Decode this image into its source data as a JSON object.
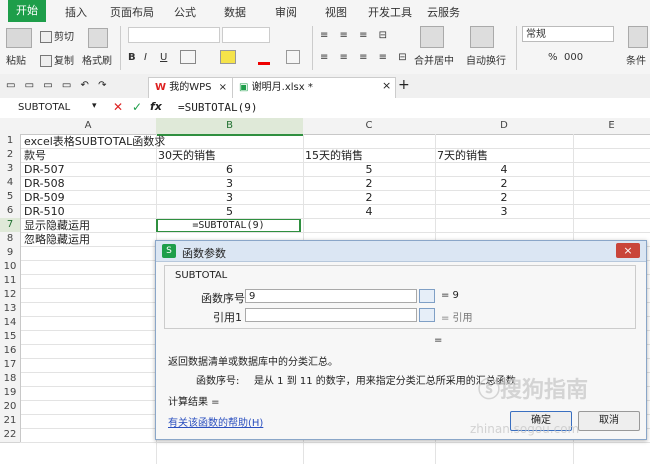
{
  "menu": {
    "tabs": [
      "开始",
      "插入",
      "页面布局",
      "公式",
      "数据",
      "审阅",
      "视图",
      "开发工具",
      "云服务"
    ],
    "active": "开始"
  },
  "ribbon": {
    "paste": "粘贴",
    "cut": "剪切",
    "copy": "复制",
    "format_painter": "格式刷",
    "bold": "B",
    "italic": "I",
    "underline": "U",
    "merge_center": "合并居中",
    "auto_wrap": "自动换行",
    "number_format": "常规",
    "percent": "%",
    "thousand": "000",
    "condition": "条件"
  },
  "doctabs": {
    "wps": "我的WPS",
    "file": "谢明月.xlsx *"
  },
  "formula_bar": {
    "name_box": "SUBTOTAL",
    "cancel": "✕",
    "confirm": "✓",
    "fx": "fx",
    "formula": "=SUBTOTAL(9)"
  },
  "columns": [
    "A",
    "B",
    "C",
    "D",
    "E"
  ],
  "rows": [
    "1",
    "2",
    "3",
    "4",
    "5",
    "6",
    "7",
    "8",
    "9",
    "10",
    "11",
    "12",
    "13",
    "14",
    "15",
    "16",
    "17",
    "18",
    "19",
    "20",
    "21",
    "22"
  ],
  "cells": {
    "a1": "excel表格SUBTOTAL函数求",
    "a2": "款号",
    "b2": "30天的销售",
    "c2": "15天的销售",
    "d2": "7天的销售",
    "a3": "DR-507",
    "b3": "6",
    "c3": "5",
    "d3": "4",
    "a4": "DR-508",
    "b4": "3",
    "c4": "2",
    "d4": "2",
    "a5": "DR-509",
    "b5": "3",
    "c5": "2",
    "d5": "2",
    "a6": "DR-510",
    "b6": "5",
    "c6": "4",
    "d6": "3",
    "a7": "显示隐藏运用",
    "b7": "=SUBTOTAL(9)",
    "a8": "忽略隐藏运用"
  },
  "dialog": {
    "title": "函数参数",
    "function_name": "SUBTOTAL",
    "arg1_label": "函数序号",
    "arg1_value": "9",
    "arg1_result": "= 9",
    "arg2_label": "引用1",
    "arg2_value": "",
    "arg2_result": "= 引用",
    "total_eq": "=",
    "description": "返回数据清单或数据库中的分类汇总。",
    "arg_desc_label": "函数序号:",
    "arg_desc": "是从 1 到 11 的数字，用来指定分类汇总所采用的汇总函数",
    "result_label": "计算结果 =",
    "help_link": "有关该函数的帮助(H)",
    "ok": "确定",
    "cancel": "取消"
  },
  "watermark": {
    "text": "搜狗指南",
    "url": "zhinan.sogou.com"
  },
  "colors": {
    "accent": "#1e9e4a",
    "selected_header": "#dfe9d8",
    "dialog_border": "#8aa6c8"
  }
}
